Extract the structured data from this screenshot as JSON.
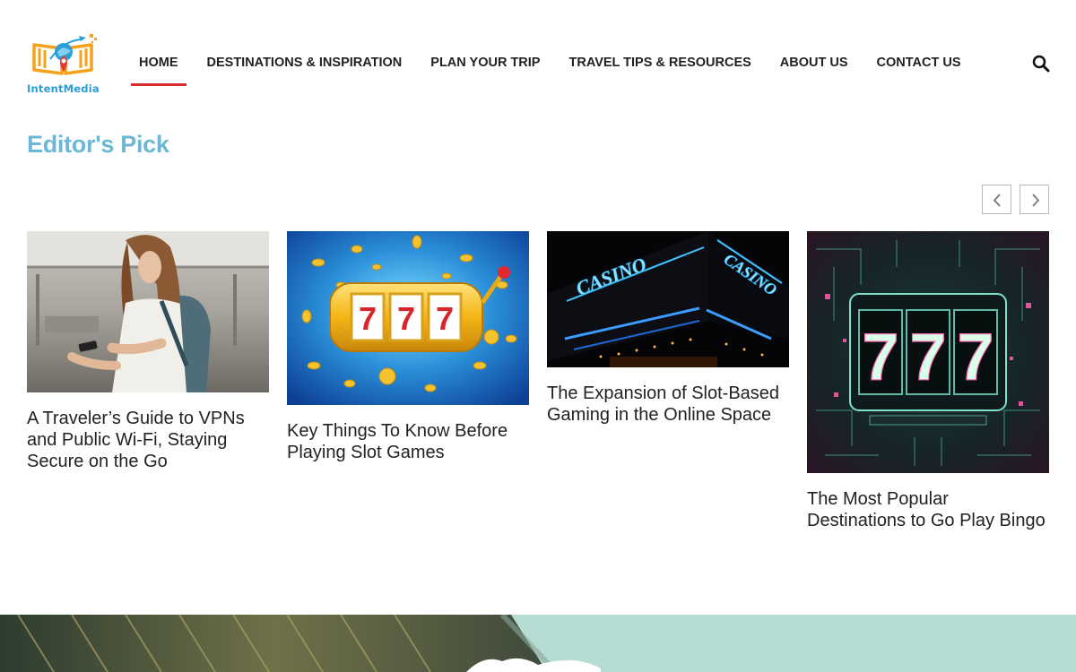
{
  "brand": {
    "name": "IntentMedia"
  },
  "nav": {
    "items": [
      {
        "label": "HOME",
        "active": true
      },
      {
        "label": "DESTINATIONS & INSPIRATION"
      },
      {
        "label": "PLAN YOUR TRIP"
      },
      {
        "label": "TRAVEL TIPS & RESOURCES"
      },
      {
        "label": "ABOUT US"
      },
      {
        "label": "CONTACT US"
      }
    ],
    "search_icon": "search-icon"
  },
  "editors_pick": {
    "title": "Editor's Pick",
    "prev_icon": "chevron-left-icon",
    "next_icon": "chevron-right-icon",
    "cards": [
      {
        "title": "A Traveler’s Guide to VPNs and Public Wi-Fi, Staying Secure on the Go",
        "image": "woman-with-phone-at-station-photo"
      },
      {
        "title": "Key Things To Know Before Playing Slot Games",
        "image": "slot-machine-777-gold-coins-illustration"
      },
      {
        "title": "The Expansion of Slot-Based Gaming in the Online Space",
        "image": "casino-neon-sign-night-photo"
      },
      {
        "title": "The Most Popular Destinations to Go Play Bingo",
        "image": "neon-777-slot-machine-illustration"
      }
    ]
  },
  "colors": {
    "accent_red": "#d62c2c",
    "section_title": "#6cb6d6",
    "brand_blue": "#2a9fd6",
    "brand_orange": "#f5a11a"
  }
}
